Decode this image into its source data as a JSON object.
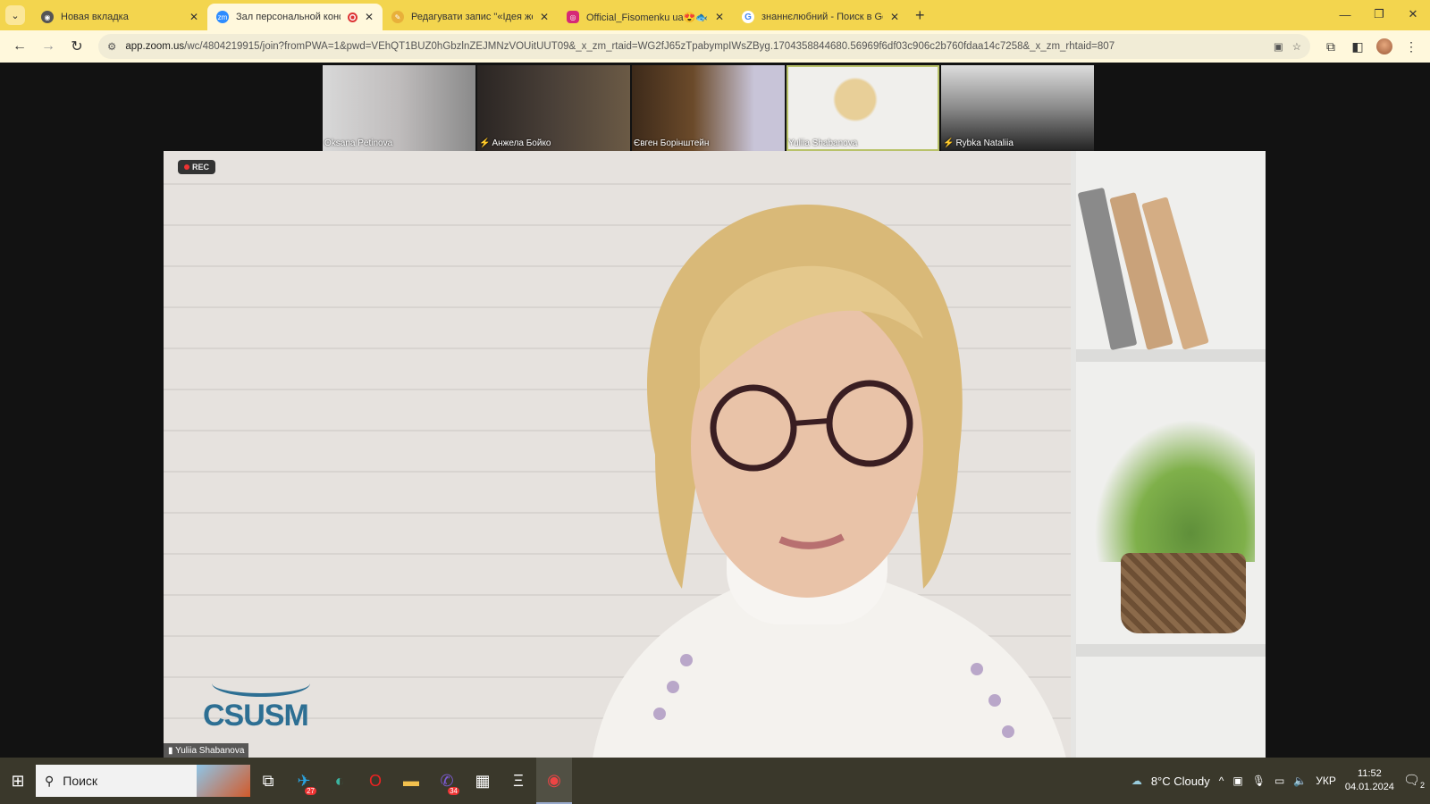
{
  "browser": {
    "tabs": [
      {
        "title": "Новая вкладка",
        "icon": "chrome-icon",
        "active": false
      },
      {
        "title": "Зал персональной конфер",
        "icon": "zoom-icon",
        "active": true,
        "recording": true
      },
      {
        "title": "Редагувати запис \"«Ідея жертв",
        "icon": "pen-icon",
        "active": false
      },
      {
        "title": "Official_Fisomenku ua😍🐟 (@",
        "icon": "instagram-icon",
        "active": false
      },
      {
        "title": "знаннєлюбний - Поиск в Goog",
        "icon": "google-icon",
        "active": false
      }
    ],
    "url_host": "app.zoom.us",
    "url_path": "/wc/4804219915/join?fromPWA=1&pwd=VEhQT1BUZ0hGbzlnZEJMNzVOUitUUT09&_x_zm_rtaid=WG2fJ65zTpabympIWsZByg.1704358844680.56969f6df03c906c2b760fdaa14c7258&_x_zm_rhtaid=807"
  },
  "meeting": {
    "participants": [
      {
        "name": "Oksana Petinova",
        "muted": false
      },
      {
        "name": "Анжела Бойко",
        "muted": true
      },
      {
        "name": "Євген Борінштейн",
        "muted": false
      },
      {
        "name": "Yuliia Shabanova",
        "muted": false,
        "selected": true
      },
      {
        "name": "Rybka Nataliia",
        "muted": true
      }
    ],
    "rec_label": "REC",
    "speaker_name": "Yuliia Shabanova",
    "logo_text": "CSUSM"
  },
  "taskbar": {
    "search_placeholder": "Поиск",
    "weather": "8°C  Cloudy",
    "language": "УКР",
    "time": "11:52",
    "date": "04.01.2024",
    "notifications": "2",
    "telegram_badge": "27",
    "viber_badge": "34"
  }
}
